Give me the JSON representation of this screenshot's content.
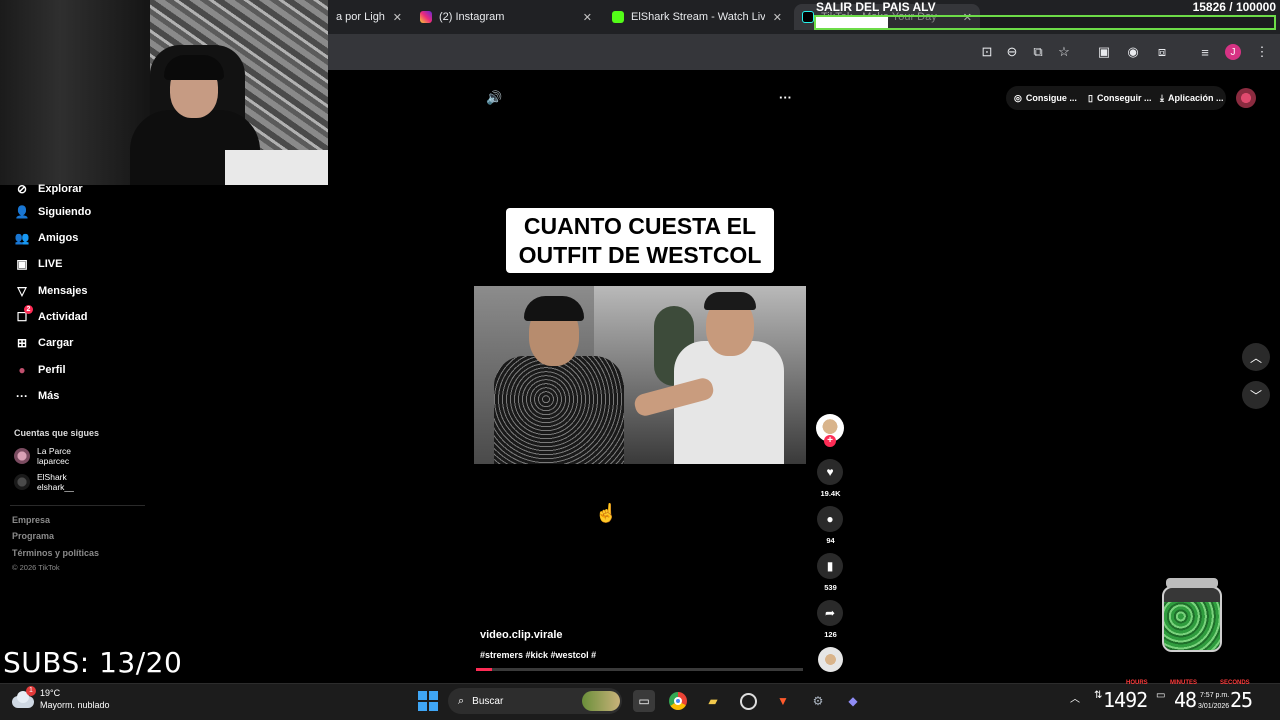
{
  "browser": {
    "tabs": [
      {
        "title": "a por Lightsh",
        "close": "✕"
      },
      {
        "title": "(2) Instagram",
        "close": "✕"
      },
      {
        "title": "ElShark Stream - Watch Live on",
        "close": "✕"
      },
      {
        "title": "TikTok - Make Your Day",
        "close": "✕"
      }
    ],
    "profile_initial": "J"
  },
  "stream_goal": {
    "title": "SALIR DEL PAIS ALV",
    "counter": "15826 / 100000",
    "progress": 0.158
  },
  "sidebar": {
    "items": [
      {
        "label": "Explorar",
        "icon": "compass-icon",
        "glyph": "⊘"
      },
      {
        "label": "Siguiendo",
        "icon": "following-icon",
        "glyph": "👤"
      },
      {
        "label": "Amigos",
        "icon": "friends-icon",
        "glyph": "👥"
      },
      {
        "label": "LIVE",
        "icon": "live-icon",
        "glyph": "▣"
      },
      {
        "label": "Mensajes",
        "icon": "messages-icon",
        "glyph": "▽"
      },
      {
        "label": "Actividad",
        "icon": "activity-icon",
        "glyph": "☐"
      },
      {
        "label": "Cargar",
        "icon": "upload-icon",
        "glyph": "⊞"
      },
      {
        "label": "Perfil",
        "icon": "profile-icon",
        "glyph": "●"
      },
      {
        "label": "Más",
        "icon": "more-icon",
        "glyph": "···"
      }
    ],
    "activity_badge": "2",
    "following_title": "Cuentas que sigues",
    "accounts": [
      {
        "name": "La Parce",
        "handle": "laparcec"
      },
      {
        "name": "ElShark",
        "handle": "elshark__"
      }
    ],
    "footer": [
      "Empresa",
      "Programa",
      "Términos y políticas"
    ],
    "copyright": "© 2026 TikTok"
  },
  "video": {
    "caption_line1": "CUANTO CUESTA EL",
    "caption_line2": "OUTFIT DE WESTCOL",
    "author": "video.clip.virale",
    "tags": "#stremers #kick #westcol #",
    "progress": 0.05,
    "likes": "19.4K",
    "comments": "94",
    "saves": "539",
    "shares": "126",
    "follow_glyph": "+"
  },
  "top_actions": {
    "btn1": "Consigue ...",
    "btn2": "Conseguir ...",
    "btn3": "Aplicación ..."
  },
  "overlay": {
    "subs": "SUBS: 13/20"
  },
  "taskbar": {
    "weather_temp": "19°C",
    "weather_desc": "Mayorm. nublado",
    "weather_badge": "1",
    "search_placeholder": "Buscar",
    "timer_hours": "1492",
    "timer_minutes": "48",
    "timer_seconds": "25",
    "timer_lbl_hours": "HOURS",
    "timer_lbl_minutes": "MINUTES",
    "timer_lbl_seconds": "SECONDS",
    "lang": "ESP\nLAA",
    "sys_time": "7:57 p.m.",
    "sys_date": "3/01/2026"
  }
}
